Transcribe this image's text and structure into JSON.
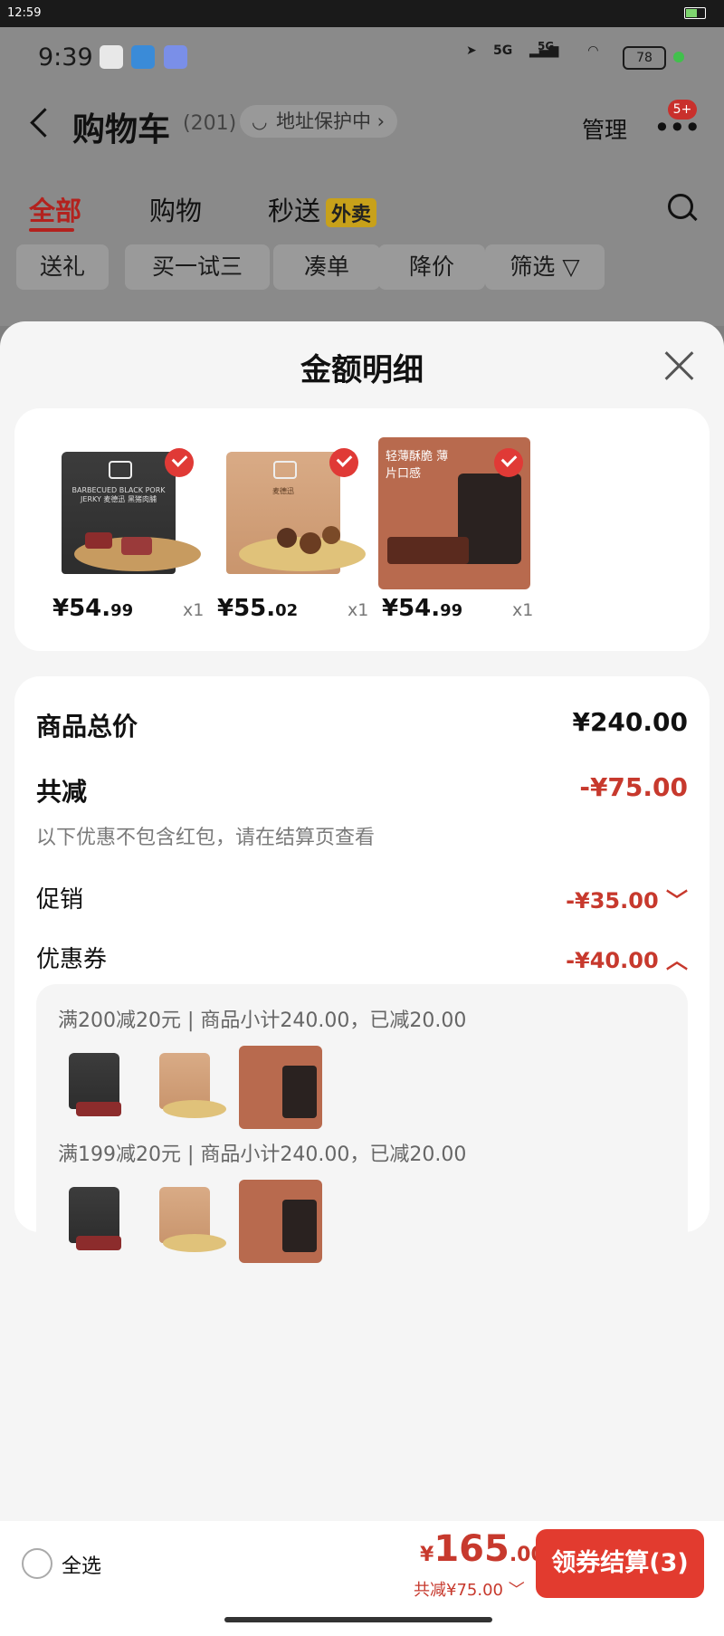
{
  "system": {
    "time": "12:59"
  },
  "background_app": {
    "status": {
      "time": "9:39",
      "network": "5G",
      "network2": "5G",
      "battery": "78"
    },
    "header": {
      "title": "购物车",
      "count": "(201)",
      "address_pill": "地址保护中 ›",
      "manage": "管理",
      "badge": "5+"
    },
    "tabs": [
      {
        "label": "全部"
      },
      {
        "label": "购物"
      },
      {
        "label": "秒送"
      }
    ],
    "waimai_tag": "外卖",
    "chips": [
      {
        "label": "送礼"
      },
      {
        "label": "买一试三"
      },
      {
        "label": "凑单"
      },
      {
        "label": "降价"
      },
      {
        "label": "筛选 ▽"
      }
    ]
  },
  "sheet": {
    "title": "金额明细",
    "products": [
      {
        "price_int": "¥54.",
        "price_dec": "99",
        "qty": "x1",
        "bag_text": "BARBECUED BLACK PORK JERKY 麦德迅 黑猪肉脯"
      },
      {
        "price_int": "¥55.",
        "price_dec": "02",
        "qty": "x1",
        "bag_text": "麦德迅"
      },
      {
        "price_int": "¥54.",
        "price_dec": "99",
        "qty": "x1",
        "bag_text": "轻薄酥脆 薄片口感"
      }
    ],
    "totals": {
      "goods_total_label": "商品总价",
      "goods_total_value": "¥240.00",
      "discount_label": "共减",
      "discount_value": "-¥75.00",
      "note": "以下优惠不包含红包，请在结算页查看",
      "promo_label": "促销",
      "promo_value": "-¥35.00 ﹀",
      "coupon_label": "优惠券",
      "coupon_value": "-¥40.00 ︿"
    },
    "coupons": [
      {
        "title": "满200减20元 | 商品小计240.00，已减20.00"
      },
      {
        "title": "满199减20元 | 商品小计240.00，已减20.00"
      }
    ]
  },
  "bottom_bar": {
    "select_all": "全选",
    "amount_yen": "¥",
    "amount_int": "165",
    "amount_dec": ".00",
    "saved": "共减¥75.00 ﹀",
    "checkout": "领券结算(3)"
  }
}
